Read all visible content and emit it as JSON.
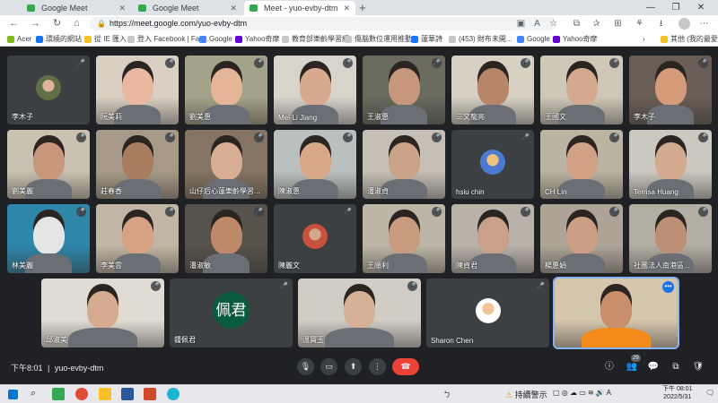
{
  "browser": {
    "tabs": [
      {
        "title": "Google Meet",
        "active": false
      },
      {
        "title": "Google Meet",
        "active": false
      },
      {
        "title": "Meet - yuo-evby-dtm",
        "active": true
      }
    ],
    "new_tab": "+",
    "window_controls": [
      "—",
      "❐",
      "✕"
    ],
    "url": "https://meet.google.com/yuo-evby-dtm",
    "bookmarks": [
      {
        "label": "Acer",
        "color": "#83b81a"
      },
      {
        "label": "環繞的網站",
        "color": "#1a73e8"
      },
      {
        "label": "從 IE 匯入",
        "color": "#f6bf26"
      },
      {
        "label": "登入 Facebook | Fac...",
        "color": "#dddddd"
      },
      {
        "label": "Google",
        "color": "#4285f4"
      },
      {
        "label": "Yahoo奇摩",
        "color": "#6001d2"
      },
      {
        "label": "教育部樂齡學習網",
        "color": "#dddddd"
      },
      {
        "label": "傷腦數位運用推動...",
        "color": "#dddddd"
      },
      {
        "label": "蓮華詩",
        "color": "#1877f2"
      },
      {
        "label": "(453) 財布未開...",
        "color": "#dddddd"
      },
      {
        "label": "Google",
        "color": "#4285f4"
      },
      {
        "label": "Yahoo奇摩",
        "color": "#6001d2"
      }
    ],
    "bookmark_more": "›",
    "other_bookmarks": "其他 (我的最愛)"
  },
  "meet": {
    "participants": [
      {
        "name": "李木子",
        "kind": "avatar",
        "bg": "#5f6f46",
        "skin": "#e0b49b"
      },
      {
        "name": "阮美莉",
        "kind": "photo",
        "bg": "#d9cfc2",
        "skin": "#e8b9a0"
      },
      {
        "name": "劉美惠",
        "kind": "photo",
        "bg": "#a5a28b",
        "skin": "#e4b597"
      },
      {
        "name": "Mei-Li Jiang",
        "kind": "photo",
        "bg": "#d8d4cc",
        "skin": "#d7a98d"
      },
      {
        "name": "王淑惠",
        "kind": "photo",
        "bg": "#6a6a5e",
        "skin": "#c7977b"
      },
      {
        "name": "三文龍亮",
        "kind": "photo",
        "bg": "#d6d1c3",
        "skin": "#b58669"
      },
      {
        "name": "王國文",
        "kind": "photo",
        "bg": "#cfc8b9",
        "skin": "#d5a98e"
      },
      {
        "name": "李木子",
        "kind": "photo",
        "bg": "#6a5d55",
        "skin": "#d39b79"
      },
      {
        "name": "劉美麗",
        "kind": "photo",
        "bg": "#c9c2b1",
        "skin": "#c9977b"
      },
      {
        "name": "莊春香",
        "kind": "photo",
        "bg": "#a69987",
        "skin": "#a97d60"
      },
      {
        "name": "山仔后心蓮樂齡學習...",
        "kind": "photo",
        "bg": "#857463",
        "skin": "#d7ad94"
      },
      {
        "name": "陳淑惠",
        "kind": "photo",
        "bg": "#b9c0bd",
        "skin": "#d9a888"
      },
      {
        "name": "潘淑貞",
        "kind": "photo",
        "bg": "#c5bfb5",
        "skin": "#caa288"
      },
      {
        "name": "hsiu chin",
        "kind": "avatar",
        "bg": "#4a7bd0",
        "skin": "#f1c27d"
      },
      {
        "name": "CH Lin",
        "kind": "photo",
        "bg": "#bbb4a2",
        "skin": "#d2a287"
      },
      {
        "name": "Terrisa Huang",
        "kind": "photo",
        "bg": "#cbc8bf",
        "skin": "#d3aa8f"
      },
      {
        "name": "林美麗",
        "kind": "photo",
        "bg": "#2e86a8",
        "skin": "#e5e5e5"
      },
      {
        "name": "李美雲",
        "kind": "photo",
        "bg": "#c1b6a5",
        "skin": "#d9a184"
      },
      {
        "name": "潘淑敏",
        "kind": "photo",
        "bg": "#57524b",
        "skin": "#bf8a6a"
      },
      {
        "name": "陳麗文",
        "kind": "avatar",
        "bg": "#c8503e",
        "skin": "#d4a68a"
      },
      {
        "name": "王順利",
        "kind": "photo",
        "bg": "#bdb6a6",
        "skin": "#c99b7f"
      },
      {
        "name": "陳貞君",
        "kind": "photo",
        "bg": "#b8b2a8",
        "skin": "#cba08a"
      },
      {
        "name": "楊惠娟",
        "kind": "photo",
        "bg": "#ada497",
        "skin": "#cc9f84"
      },
      {
        "name": "社團法人南港區...",
        "kind": "photo",
        "bg": "#b3aea3",
        "skin": "#bd8f74"
      },
      {
        "name": "邱淑美",
        "kind": "photo",
        "bg": "#e1dcd3",
        "skin": "#d6ab90"
      },
      {
        "name": "鍾佩君",
        "kind": "initials",
        "initials": "佩君",
        "bg": "#0b5b3e"
      },
      {
        "name": "溫寶玉",
        "kind": "photo",
        "bg": "#d1cdc5",
        "skin": "#d7b098"
      },
      {
        "name": "Sharon Chen",
        "kind": "avatar",
        "bg": "#ffffff",
        "skin": "#f3c596"
      },
      {
        "name": "",
        "kind": "photo",
        "bg": "#d5c6ae",
        "skin": "#c98f6c",
        "active": true
      }
    ],
    "time": "下午8:01",
    "separator": "|",
    "meeting_code": "yuo-evby-dtm",
    "people_count": "29",
    "controls": {
      "mic": "🎙",
      "camera": "▭",
      "present": "⬆",
      "more": "⋮",
      "end": "☎"
    },
    "right_icons": {
      "info": "ⓘ",
      "people": "👥",
      "chat": "💬",
      "activities": "⧉",
      "safety": "🛡"
    },
    "mic_muted_glyph": "🎤",
    "more_options_glyph": "•••"
  },
  "taskbar": {
    "weather": "持續警示",
    "status_text": "ㄅ",
    "time": "下午 08:01",
    "date": "2022/5/31"
  }
}
